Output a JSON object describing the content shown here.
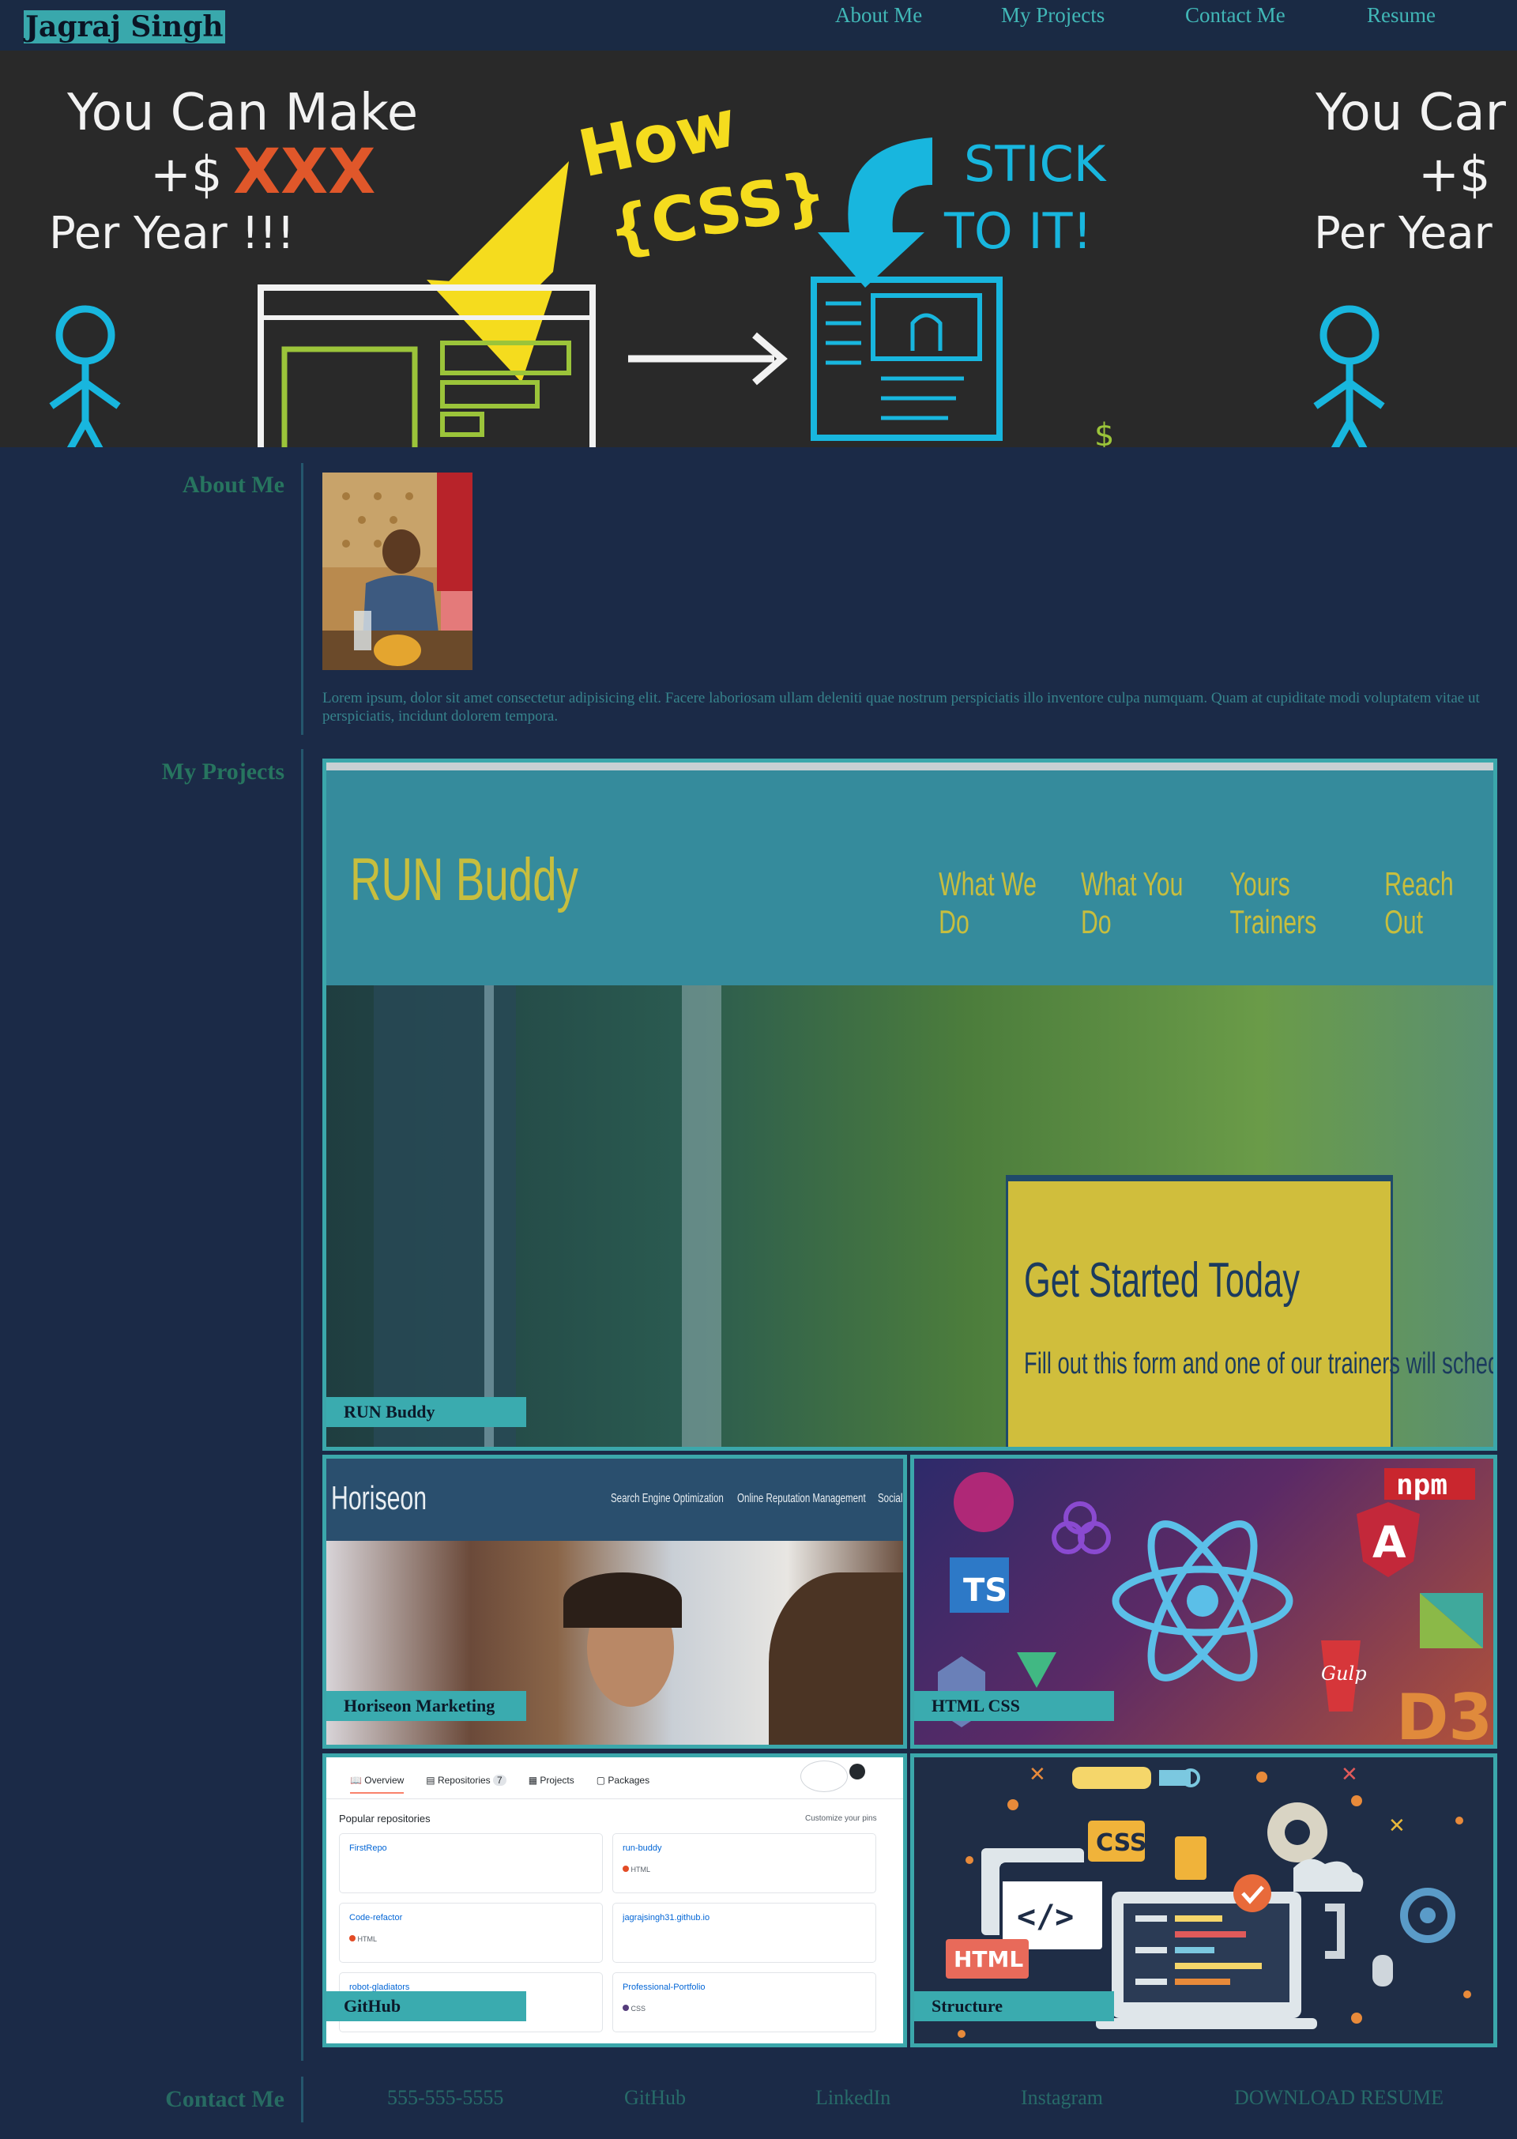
{
  "header": {
    "brand": "Jagraj Singh",
    "nav": [
      "About Me",
      "My Projects",
      "Contact Me",
      "Resume"
    ]
  },
  "hero": {
    "left_text": [
      "You Can Make",
      "+$",
      "XXX",
      "Per Year !!!"
    ],
    "how_text": [
      "How",
      "{CSS}"
    ],
    "stick_text": [
      "STICK",
      "TO IT!"
    ],
    "right_text": [
      "You Car",
      "+$",
      "Per Year"
    ]
  },
  "about": {
    "title": "About Me",
    "text": "Lorem ipsum, dolor sit amet consectetur adipisicing elit. Facere laboriosam ullam deleniti quae nostrum perspiciatis illo inventore culpa numquam. Quam at cupiditate modi voluptatem vitae ut perspiciatis, incidunt dolorem tempora."
  },
  "projects": {
    "title": "My Projects",
    "items": [
      {
        "label": "RUN Buddy"
      },
      {
        "label": "Horiseon Marketing"
      },
      {
        "label": "HTML CSS"
      },
      {
        "label": "GitHub"
      },
      {
        "label": "Structure"
      }
    ],
    "runbuddy": {
      "logo": "RUN Buddy",
      "nav": [
        "What We Do",
        "What You Do",
        "Yours Trainers",
        "Reach Out"
      ],
      "cta_title": "Get Started Today",
      "cta_text": "Fill out this form and one of our trainers will schedule a consult"
    },
    "horiseon": {
      "logo": "Horiseon",
      "nav": [
        "Search Engine Optimization",
        "Online Reputation Management",
        "Social Media Marketing"
      ]
    },
    "htmlcss": {
      "npm": "npm",
      "ts": "TS",
      "gulp": "Gulp",
      "d3": "D3",
      "angular": "A"
    },
    "github": {
      "tabs": [
        "Overview",
        "Repositories",
        "Projects",
        "Packages"
      ],
      "repo_count": "7",
      "popular": "Popular repositories",
      "customize": "Customize your pins",
      "repos": [
        {
          "name": "FirstRepo",
          "lang": ""
        },
        {
          "name": "run-buddy",
          "lang": "HTML"
        },
        {
          "name": "Code-refactor",
          "lang": "HTML"
        },
        {
          "name": "jagrajsingh31.github.io",
          "lang": ""
        },
        {
          "name": "robot-gladiators",
          "lang": ""
        },
        {
          "name": "Professional-Portfolio",
          "lang": "CSS"
        }
      ]
    },
    "structure": {
      "css": "CSS",
      "html": "HTML",
      "code": "</>"
    }
  },
  "contact": {
    "title": "Contact Me",
    "links": [
      "555-555-5555",
      "GitHub",
      "LinkedIn",
      "Instagram",
      "DOWNLOAD RESUME"
    ]
  },
  "colors": {
    "background": "#1b2a47",
    "accent": "#3ba7ab",
    "heading": "#27755f"
  }
}
